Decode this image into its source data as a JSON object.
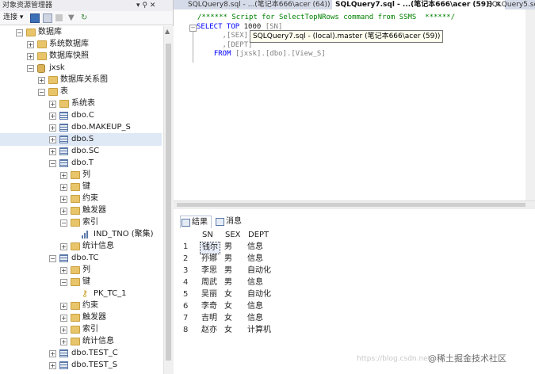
{
  "explorer": {
    "title": "对象资源管理器",
    "pin_icon": "▾ ⚲ ✕",
    "toolbar": {
      "connect_label": "连接 ▾"
    },
    "tree": [
      {
        "label": "数据库",
        "level": 2,
        "icon": "folder-icon",
        "expander": "−"
      },
      {
        "label": "系统数据库",
        "level": 3,
        "icon": "folder-icon",
        "expander": "+"
      },
      {
        "label": "数据库快照",
        "level": 3,
        "icon": "folder-icon",
        "expander": "+"
      },
      {
        "label": "jxsk",
        "level": 3,
        "icon": "database-icon",
        "expander": "−"
      },
      {
        "label": "数据库关系图",
        "level": 4,
        "icon": "folder-icon",
        "expander": "+"
      },
      {
        "label": "表",
        "level": 4,
        "icon": "folder-icon",
        "expander": "−"
      },
      {
        "label": "系统表",
        "level": 5,
        "icon": "folder-icon",
        "expander": "+"
      },
      {
        "label": "dbo.C",
        "level": 5,
        "icon": "table-icon",
        "expander": "+"
      },
      {
        "label": "dbo.MAKEUP_S",
        "level": 5,
        "icon": "table-icon",
        "expander": "+"
      },
      {
        "label": "dbo.S",
        "level": 5,
        "icon": "table-icon",
        "expander": "+",
        "selected": true
      },
      {
        "label": "dbo.SC",
        "level": 5,
        "icon": "table-icon",
        "expander": "+"
      },
      {
        "label": "dbo.T",
        "level": 5,
        "icon": "table-icon",
        "expander": "−"
      },
      {
        "label": "列",
        "level": 6,
        "icon": "folder-icon",
        "expander": "+"
      },
      {
        "label": "键",
        "level": 6,
        "icon": "folder-icon",
        "expander": "+"
      },
      {
        "label": "约束",
        "level": 6,
        "icon": "folder-icon",
        "expander": "+"
      },
      {
        "label": "触发器",
        "level": 6,
        "icon": "folder-icon",
        "expander": "+"
      },
      {
        "label": "索引",
        "level": 6,
        "icon": "folder-icon",
        "expander": "−"
      },
      {
        "label": "IND_TNO (聚集)",
        "level": 7,
        "icon": "index-icon",
        "expander": ""
      },
      {
        "label": "统计信息",
        "level": 6,
        "icon": "folder-icon",
        "expander": "+"
      },
      {
        "label": "dbo.TC",
        "level": 5,
        "icon": "table-icon",
        "expander": "−"
      },
      {
        "label": "列",
        "level": 6,
        "icon": "folder-icon",
        "expander": "+"
      },
      {
        "label": "键",
        "level": 6,
        "icon": "folder-icon",
        "expander": "−"
      },
      {
        "label": "PK_TC_1",
        "level": 7,
        "icon": "key-icon",
        "expander": ""
      },
      {
        "label": "约束",
        "level": 6,
        "icon": "folder-icon",
        "expander": "+"
      },
      {
        "label": "触发器",
        "level": 6,
        "icon": "folder-icon",
        "expander": "+"
      },
      {
        "label": "索引",
        "level": 6,
        "icon": "folder-icon",
        "expander": "+"
      },
      {
        "label": "统计信息",
        "level": 6,
        "icon": "folder-icon",
        "expander": "+"
      },
      {
        "label": "dbo.TEST_C",
        "level": 5,
        "icon": "table-icon",
        "expander": "+"
      },
      {
        "label": "dbo.TEST_S",
        "level": 5,
        "icon": "table-icon",
        "expander": "+"
      }
    ]
  },
  "tabs": [
    {
      "label": "SQLQuery8.sql - ...(笔记本666\\acer (64))",
      "active": false
    },
    {
      "label": "SQLQuery7.sql - ...(笔记本666\\acer (59))",
      "active": true
    },
    {
      "label": "SQLQuery5.sq",
      "active": false
    }
  ],
  "tab_close_icon": "✕",
  "editor": {
    "lines": [
      {
        "parts": [
          {
            "t": "/****** Script for SelectTopNRows command from SSMS  ******/",
            "c": "cm"
          }
        ]
      },
      {
        "parts": [
          {
            "t": "SELECT TOP ",
            "c": "kw"
          },
          {
            "t": "1000 ",
            "c": ""
          },
          {
            "t": "[SN]",
            "c": "id"
          }
        ]
      },
      {
        "parts": [
          {
            "t": "      ,",
            "c": "gr"
          },
          {
            "t": "[SEX]",
            "c": "id"
          }
        ]
      },
      {
        "parts": [
          {
            "t": "      ,",
            "c": "gr"
          },
          {
            "t": "[DEPT]",
            "c": "id"
          }
        ]
      },
      {
        "parts": [
          {
            "t": "  FROM ",
            "c": "kw"
          },
          {
            "t": "[jxsk]",
            "c": "id"
          },
          {
            "t": ".",
            "c": "gr"
          },
          {
            "t": "[dbo]",
            "c": "id"
          },
          {
            "t": ".",
            "c": "gr"
          },
          {
            "t": "[View_S]",
            "c": "id"
          }
        ]
      }
    ],
    "tooltip": "SQLQuery7.sql - (local).master (笔记本666\\acer (59))"
  },
  "results": {
    "tabs": [
      {
        "label": "结果",
        "active": true
      },
      {
        "label": "消息",
        "active": false
      }
    ],
    "columns": [
      "SN",
      "SEX",
      "DEPT"
    ],
    "rows": [
      [
        "1",
        "钱尔",
        "男",
        "信息"
      ],
      [
        "2",
        "孙娜",
        "男",
        "信息"
      ],
      [
        "3",
        "李思",
        "男",
        "自动化"
      ],
      [
        "4",
        "周武",
        "男",
        "信息"
      ],
      [
        "5",
        "吴丽",
        "女",
        "自动化"
      ],
      [
        "6",
        "李奇",
        "女",
        "信息"
      ],
      [
        "7",
        "吉明",
        "女",
        "信息"
      ],
      [
        "8",
        "赵亦",
        "女",
        "计算机"
      ]
    ]
  },
  "watermark": "https://blog.csdn.net",
  "brand": "@稀土掘金技术社区"
}
